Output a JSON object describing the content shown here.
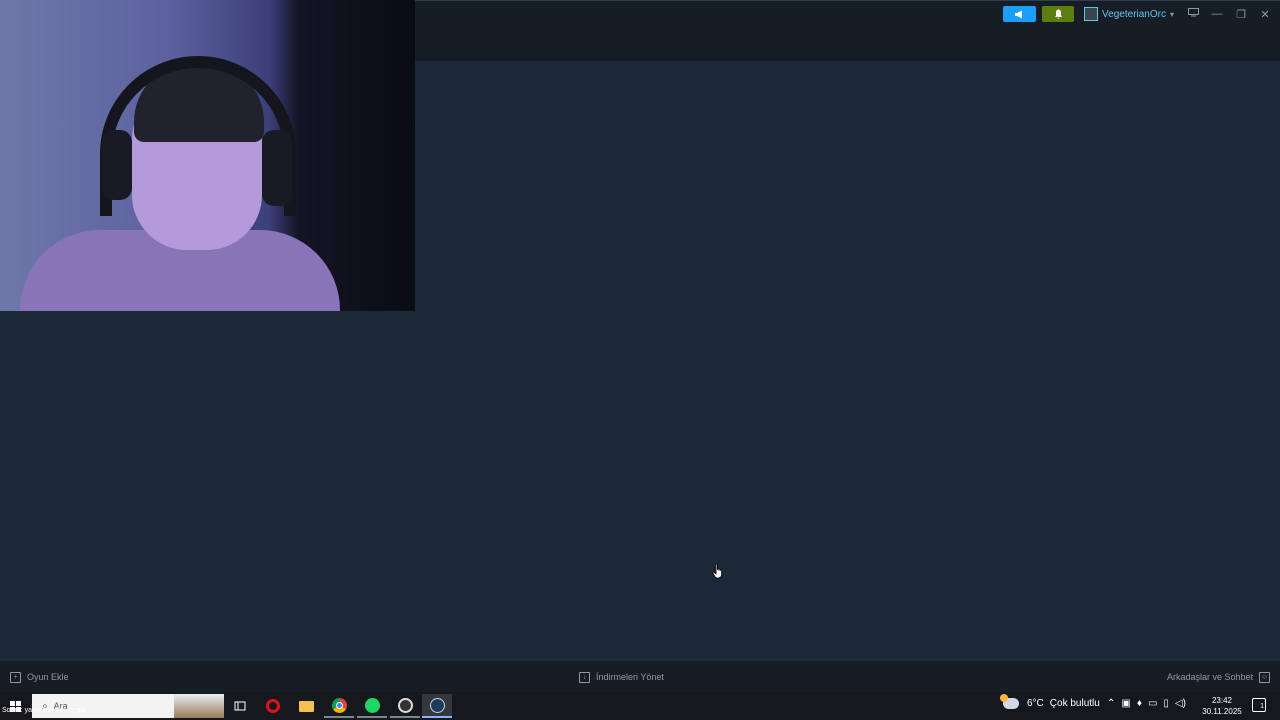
{
  "steam": {
    "username": "VegeterianOrc",
    "bottom_bar": {
      "add_game": "Oyun Ekle",
      "manage_downloads": "İndirmeleri Yönet",
      "friends_chat": "Arkadaşlar ve Sohbet"
    },
    "window_controls": {
      "minimize": "—",
      "restore": "❐",
      "close": "✕"
    },
    "icons": {
      "announce": "megaphone-icon",
      "notify": "bell-icon"
    },
    "colors": {
      "announce_button": "#1a9fff",
      "notify_button": "#5c7e10",
      "accent": "#67c1f5",
      "background": "#1b2838"
    }
  },
  "taskbar": {
    "overlay_text": "Sonra: yarın 1 aralık ve pzt",
    "search_placeholder": "Ara",
    "apps": [
      "task-view",
      "opera",
      "file-explorer",
      "chrome",
      "spotify",
      "clock-app",
      "steam"
    ],
    "weather": {
      "temp": "6°C",
      "condition": "Çok bulutlu"
    },
    "time": "23:42",
    "date": "30.11.2025",
    "notifications_count": "1"
  }
}
